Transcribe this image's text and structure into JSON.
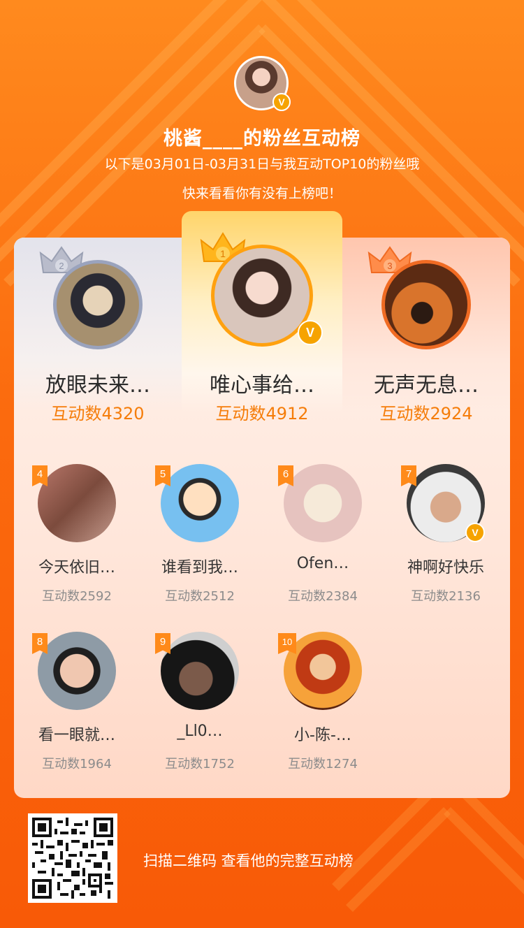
{
  "host": {
    "title": "桃酱____的粉丝互动榜",
    "date_range_text": "以下是03月01日-03月31日与我互动TOP10的粉丝哦",
    "invite_text": "快来看看你有没有上榜吧！",
    "verified_icon": "v-badge-icon"
  },
  "top3": [
    {
      "rank": "2",
      "name": "放眼未来…",
      "count": "互动数4320"
    },
    {
      "rank": "1",
      "name": "唯心事给…",
      "count": "互动数4912"
    },
    {
      "rank": "3",
      "name": "无声无息…",
      "count": "互动数2924"
    }
  ],
  "ranks": [
    {
      "rank": "4",
      "name": "今天依旧…",
      "count": "互动数2592"
    },
    {
      "rank": "5",
      "name": "谁看到我…",
      "count": "互动数2512"
    },
    {
      "rank": "6",
      "name": "Ofen…",
      "count": "互动数2384"
    },
    {
      "rank": "7",
      "name": "神啊好快乐",
      "count": "互动数2136"
    },
    {
      "rank": "8",
      "name": "看一眼就…",
      "count": "互动数1964"
    },
    {
      "rank": "9",
      "name": "_Ll0…",
      "count": "互动数1752"
    },
    {
      "rank": "10",
      "name": "小-陈-…",
      "count": "互动数1274"
    }
  ],
  "footer": {
    "scan_text": "扫描二维码 查看他的完整互动榜"
  },
  "colors": {
    "accent": "#f57d0a",
    "background_top": "#ff8a1e",
    "background_bottom": "#f85a07",
    "gold": "#f6a300"
  }
}
